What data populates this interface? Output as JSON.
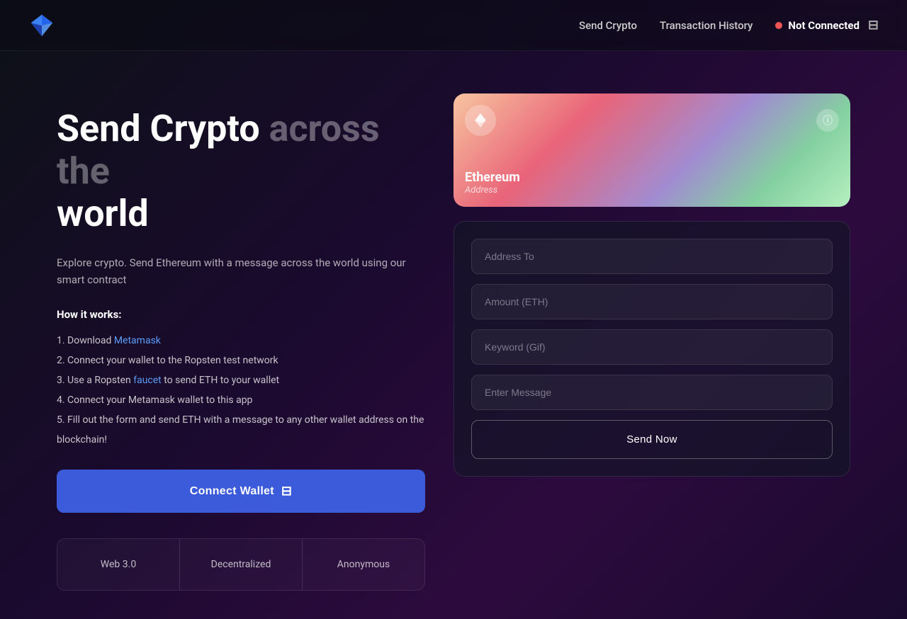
{
  "nav": {
    "links": [
      {
        "label": "Send Crypto",
        "id": "send-crypto"
      },
      {
        "label": "Transaction History",
        "id": "transaction-history"
      }
    ],
    "status": {
      "label": "Not Connected",
      "connected": false
    }
  },
  "hero": {
    "title_main": "Send Crypto",
    "title_muted": "across the",
    "title_end": "world",
    "description": "Explore crypto. Send Ethereum with a message across the world using our smart contract",
    "how_it_works_title": "How it works:",
    "steps": [
      {
        "text": "Download ",
        "link": "Metamask",
        "link_url": "#",
        "rest": ""
      },
      {
        "text": "Connect your wallet to the Ropsten test network",
        "link": "",
        "link_url": "",
        "rest": ""
      },
      {
        "text": "Use a Ropsten ",
        "link": "faucet",
        "link_url": "#",
        "rest": " to send ETH to your wallet"
      },
      {
        "text": "Connect your Metamask wallet to this app",
        "link": "",
        "link_url": "",
        "rest": ""
      },
      {
        "text": "Fill out the form and send ETH with a message to any other wallet address on the blockchain!",
        "link": "",
        "link_url": "",
        "rest": ""
      }
    ],
    "connect_button": "Connect Wallet"
  },
  "features": [
    {
      "label": "Web 3.0"
    },
    {
      "label": "Decentralized"
    },
    {
      "label": "Anonymous"
    }
  ],
  "wallet_card": {
    "name": "Ethereum",
    "address": "Address"
  },
  "form": {
    "fields": [
      {
        "placeholder": "Address To",
        "id": "address-to",
        "type": "text"
      },
      {
        "placeholder": "Amount (ETH)",
        "id": "amount-eth",
        "type": "number"
      },
      {
        "placeholder": "Keyword (Gif)",
        "id": "keyword-gif",
        "type": "text"
      },
      {
        "placeholder": "Enter Message",
        "id": "enter-message",
        "type": "text"
      }
    ],
    "send_button": "Send Now"
  }
}
